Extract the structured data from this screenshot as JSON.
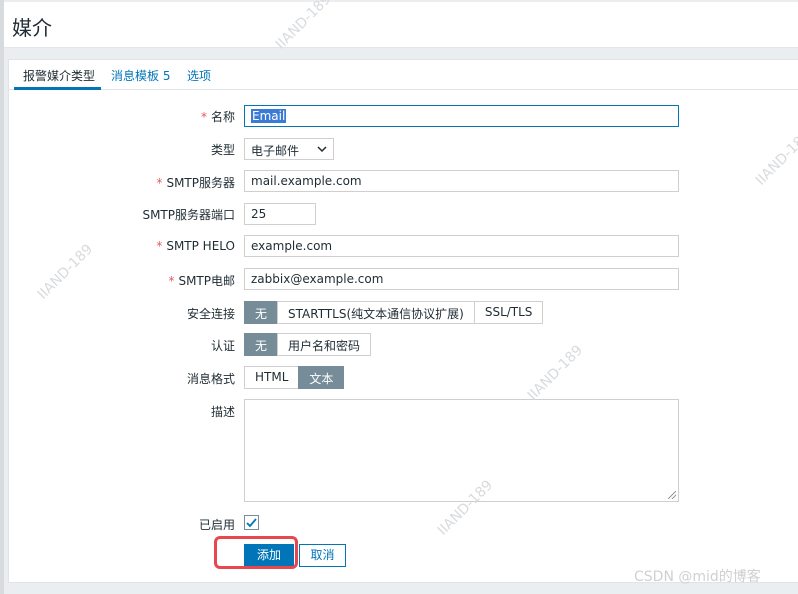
{
  "page": {
    "title": "媒介"
  },
  "tabs": [
    {
      "label": "报警媒介类型"
    },
    {
      "label": "消息模板 5"
    },
    {
      "label": "选项"
    }
  ],
  "form": {
    "name": {
      "label": "名称",
      "value": "Email"
    },
    "type": {
      "label": "类型",
      "value": "电子邮件"
    },
    "smtp_server": {
      "label": "SMTP服务器",
      "value": "mail.example.com"
    },
    "smtp_port": {
      "label": "SMTP服务器端口",
      "value": "25"
    },
    "smtp_helo": {
      "label": "SMTP HELO",
      "value": "example.com"
    },
    "smtp_email": {
      "label": "SMTP电邮",
      "value": "zabbix@example.com"
    },
    "security": {
      "label": "安全连接",
      "options": [
        "无",
        "STARTTLS(纯文本通信协议扩展)",
        "SSL/TLS"
      ],
      "selected": "无"
    },
    "auth": {
      "label": "认证",
      "options": [
        "无",
        "用户名和密码"
      ],
      "selected": "无"
    },
    "format": {
      "label": "消息格式",
      "options": [
        "HTML",
        "文本"
      ],
      "selected": "文本"
    },
    "description": {
      "label": "描述",
      "value": ""
    },
    "enabled": {
      "label": "已启用",
      "checked": true
    }
  },
  "buttons": {
    "add": "添加",
    "cancel": "取消"
  },
  "watermarks": [
    "IIAND-189",
    "IIAND-189",
    "IIAND-189",
    "IIAND-189",
    "IIAND-189"
  ],
  "credit": "CSDN @mid的博客",
  "colors": {
    "accent": "#0275b8",
    "toggle_on": "#768d99",
    "required": "#e45959",
    "highlight": "#e8474d"
  }
}
